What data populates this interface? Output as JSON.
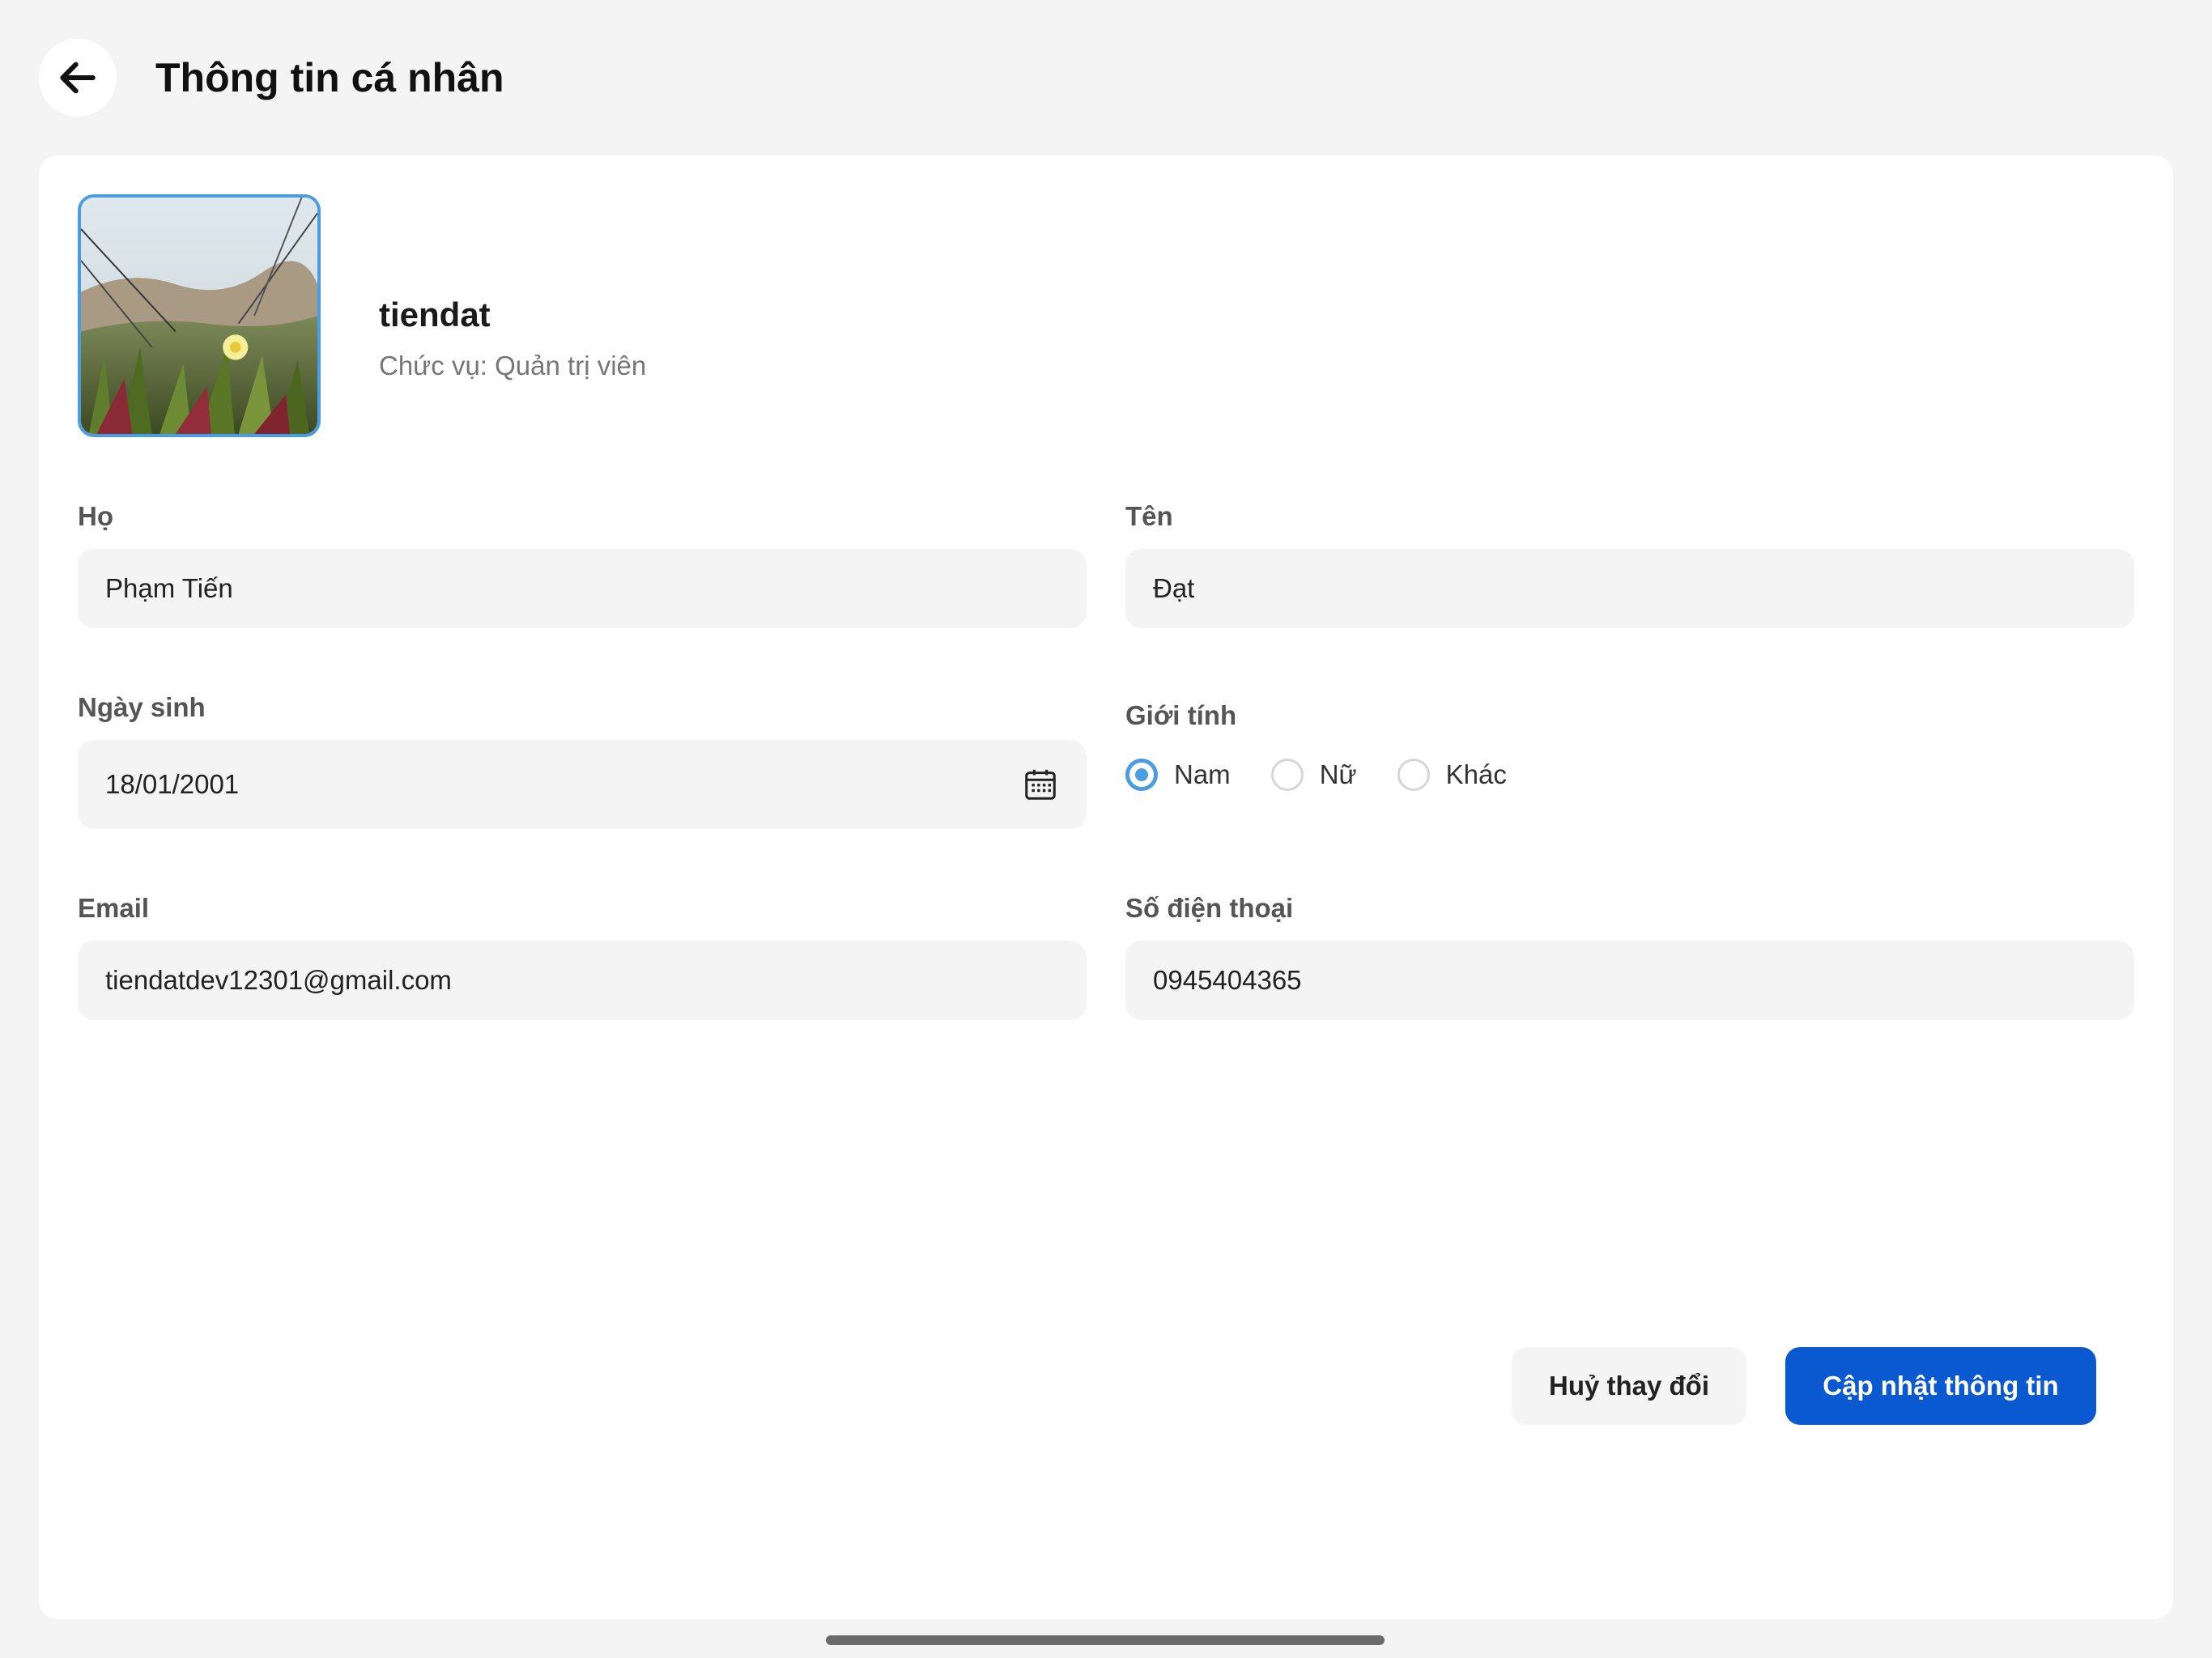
{
  "header": {
    "title": "Thông tin cá nhân",
    "back_icon": "arrow-left-icon"
  },
  "profile": {
    "username": "tiendat",
    "role": "Chức vụ: Quản trị viên",
    "avatar_description": "avatar-photo"
  },
  "form": {
    "last_name": {
      "label": "Họ",
      "value": "Phạm Tiến"
    },
    "first_name": {
      "label": "Tên",
      "value": "Đạt"
    },
    "birthday": {
      "label": "Ngày sinh",
      "value": "18/01/2001",
      "icon": "calendar-icon"
    },
    "gender": {
      "label": "Giới tính",
      "options": [
        {
          "label": "Nam",
          "checked": true
        },
        {
          "label": "Nữ",
          "checked": false
        },
        {
          "label": "Khác",
          "checked": false
        }
      ]
    },
    "email": {
      "label": "Email",
      "value": "tiendatdev12301@gmail.com"
    },
    "phone": {
      "label": "Số điện thoại",
      "value": "0945404365"
    }
  },
  "actions": {
    "cancel_label": "Huỷ thay đổi",
    "update_label": "Cập nhật thông tin"
  },
  "colors": {
    "accent": "#4a9de0",
    "primary_button": "#0a59d0",
    "background": "#f4f4f4",
    "card": "#ffffff"
  }
}
